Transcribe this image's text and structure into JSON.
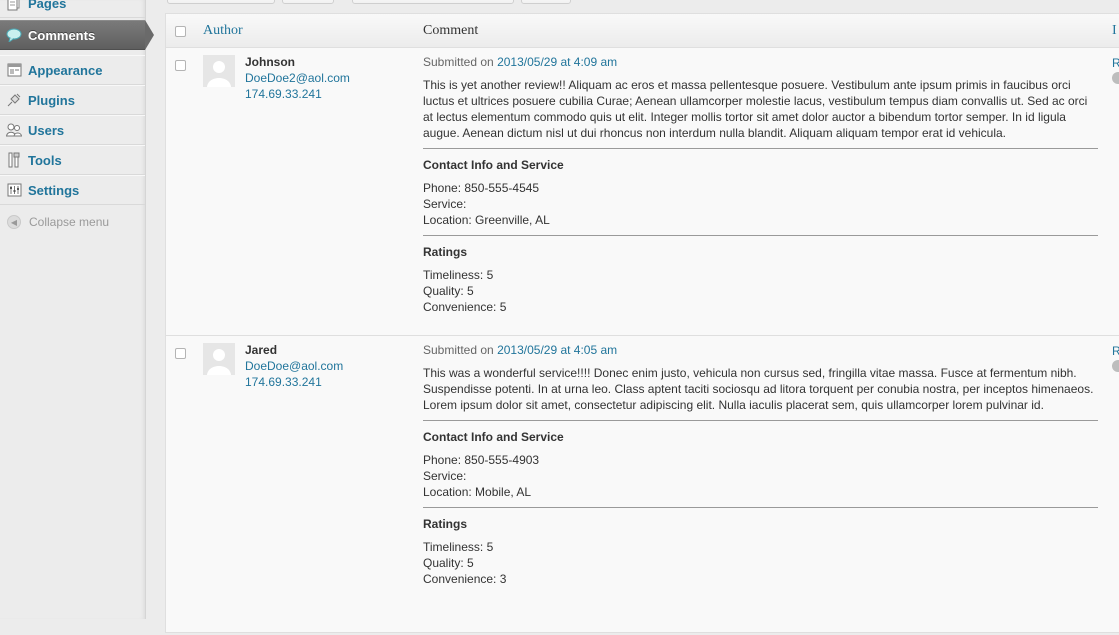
{
  "sidebar": {
    "items": [
      {
        "label": "Pages",
        "icon": "pages-icon"
      },
      {
        "label": "Comments",
        "icon": "comments-icon",
        "current": true
      },
      {
        "label": "Appearance",
        "icon": "appearance-icon"
      },
      {
        "label": "Plugins",
        "icon": "plugins-icon"
      },
      {
        "label": "Users",
        "icon": "users-icon"
      },
      {
        "label": "Tools",
        "icon": "tools-icon"
      },
      {
        "label": "Settings",
        "icon": "settings-icon"
      }
    ],
    "collapse_label": "Collapse menu"
  },
  "table": {
    "headers": {
      "author": "Author",
      "comment": "Comment",
      "in_response": "I"
    },
    "rows": [
      {
        "author": "Johnson",
        "email": "DoeDoe2@aol.com",
        "ip": "174.69.33.241",
        "submitted_prefix": "Submitted on",
        "submitted_date": "2013/05/29 at 4:09 am",
        "body": "This is yet another review!! Aliquam ac eros et massa pellentesque posuere. Vestibulum ante ipsum primis in faucibus orci luctus et ultrices posuere cubilia Curae; Aenean ullamcorper molestie lacus, vestibulum tempus diam convallis ut. Sed ac orci at lectus elementum commodo quis ut elit. Integer mollis tortor sit amet dolor auctor a bibendum tortor semper. In id ligula augue. Aenean dictum nisl ut dui rhoncus non interdum nulla blandit. Aliquam aliquam tempor erat id vehicula.",
        "contact_title": "Contact Info and Service",
        "phone": "Phone: 850-555-4545",
        "service": "Service:",
        "location": "Location: Greenville, AL",
        "ratings_title": "Ratings",
        "timeliness": "Timeliness: 5",
        "quality": "Quality: 5",
        "convenience": "Convenience: 5",
        "right_link": "R"
      },
      {
        "author": "Jared",
        "email": "DoeDoe@aol.com",
        "ip": "174.69.33.241",
        "submitted_prefix": "Submitted on",
        "submitted_date": "2013/05/29 at 4:05 am",
        "body": "This was a wonderful service!!!! Donec enim justo, vehicula non cursus sed, fringilla vitae massa. Fusce at fermentum nibh. Suspendisse potenti. In at urna leo. Class aptent taciti sociosqu ad litora torquent per conubia nostra, per inceptos himenaeos. Lorem ipsum dolor sit amet, consectetur adipiscing elit. Nulla iaculis placerat sem, quis ullamcorper lorem pulvinar id.",
        "contact_title": "Contact Info and Service",
        "phone": "Phone: 850-555-4903",
        "service": "Service:",
        "location": "Location: Mobile, AL",
        "ratings_title": "Ratings",
        "timeliness": "Timeliness: 5",
        "quality": "Quality: 5",
        "convenience": "Convenience: 3",
        "right_link": "R"
      }
    ]
  },
  "colors": {
    "link": "#21759b",
    "current_menu": "#6a6a6a"
  }
}
